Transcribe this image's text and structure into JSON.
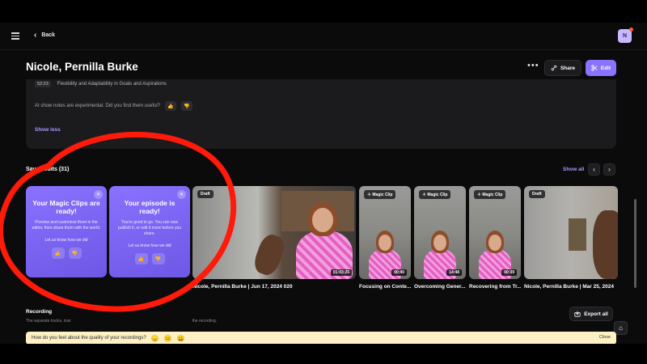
{
  "header": {
    "back_label": "Back",
    "avatar_initial": "N"
  },
  "page": {
    "title": "Nicole, Pernilla Burke",
    "share_label": "Share",
    "edit_label": "Edit",
    "more_label": "•••"
  },
  "notes": {
    "chapter_time": "52:23",
    "chapter_text": "Flexibility and Adaptability in Goals and Aspirations",
    "ai_question": "AI show notes are experimental. Did you find them useful?",
    "show_less": "Show less"
  },
  "saved_edits": {
    "title": "Saved edits (31)",
    "show_all": "Show all",
    "promo_cards": [
      {
        "title": "Your Magic Clips are ready!",
        "body": "Preview and customize them in the editor, then share them with the world.",
        "feedback": "Let us know how we did"
      },
      {
        "title": "Your episode is ready!",
        "body": "You're good to go. You can now publish it, or edit it more before you share.",
        "feedback": "Let us know how we did"
      }
    ],
    "clips": [
      {
        "badge": "Draft",
        "duration": "01:03:25",
        "label": "Nicole, Pernilla Burke | Jun 17, 2024 020"
      },
      {
        "badge": "Magic Clip",
        "duration": "00:40",
        "label": "Focusing on Conte..."
      },
      {
        "badge": "Magic Clip",
        "duration": "14:48",
        "label": "Overcoming Gener..."
      },
      {
        "badge": "Magic Clip",
        "duration": "00:39",
        "label": "Recovering from Tr..."
      },
      {
        "badge": "Draft",
        "duration": "",
        "label": "Nicole, Pernilla Burke | Mar 25, 2024"
      }
    ]
  },
  "recordings": {
    "title": "Recording",
    "subtitle": "The separate tracks, tran",
    "subtitle_end": "the recording.",
    "export_label": "Export all"
  },
  "survey": {
    "question": "How do you feel about the quality of your recordings?",
    "close_label": "Close"
  },
  "icons": {
    "thumb_up": "👍",
    "thumb_down": "👎",
    "emoji_sad": "😞",
    "emoji_neutral": "😐",
    "emoji_happy": "😀"
  },
  "colors": {
    "accent": "#8a73ff",
    "link": "#a699ff",
    "annotation": "#ff1a0a",
    "survey_bg": "#fdf0c4"
  }
}
